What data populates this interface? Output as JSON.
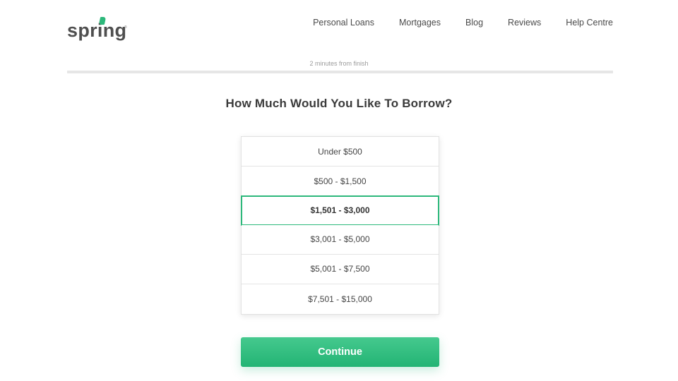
{
  "brand": {
    "name": "spring",
    "mark": "®",
    "accent": "#2db87b"
  },
  "nav": [
    {
      "label": "Personal Loans"
    },
    {
      "label": "Mortgages"
    },
    {
      "label": "Blog"
    },
    {
      "label": "Reviews"
    },
    {
      "label": "Help Centre"
    }
  ],
  "progress": {
    "label": "2 minutes from finish"
  },
  "question": "How Much Would You Like To Borrow?",
  "options": [
    {
      "label": "Under $500",
      "selected": false
    },
    {
      "label": "$500 - $1,500",
      "selected": false
    },
    {
      "label": "$1,501 - $3,000",
      "selected": true
    },
    {
      "label": "$3,001 - $5,000",
      "selected": false
    },
    {
      "label": "$5,001 - $7,500",
      "selected": false
    },
    {
      "label": "$7,501 - $15,000",
      "selected": false
    }
  ],
  "continue_label": "Continue"
}
